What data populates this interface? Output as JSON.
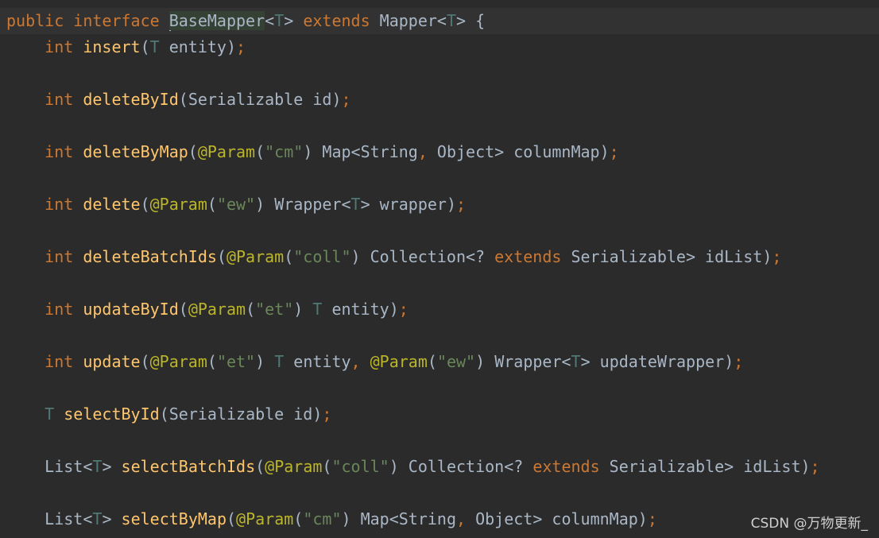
{
  "lines": [
    [
      {
        "t": "public",
        "k": "kw"
      },
      {
        "t": " "
      },
      {
        "t": "interface",
        "k": "kw"
      },
      {
        "t": " "
      },
      {
        "t": "CARET"
      },
      {
        "t": "BaseMapper",
        "k": "type",
        "h": true
      },
      {
        "t": "<",
        "k": "punc"
      },
      {
        "t": "T",
        "k": "gen"
      },
      {
        "t": ">",
        "k": "punc"
      },
      {
        "t": " "
      },
      {
        "t": "extends",
        "k": "kw"
      },
      {
        "t": " "
      },
      {
        "t": "Mapper",
        "k": "type"
      },
      {
        "t": "<",
        "k": "punc"
      },
      {
        "t": "T",
        "k": "gen"
      },
      {
        "t": ">",
        "k": "punc"
      },
      {
        "t": " "
      },
      {
        "t": "{",
        "k": "punc"
      }
    ],
    [
      {
        "t": "    "
      },
      {
        "t": "int",
        "k": "kw"
      },
      {
        "t": " "
      },
      {
        "t": "insert",
        "k": "fn"
      },
      {
        "t": "(",
        "k": "punc"
      },
      {
        "t": "T",
        "k": "gen"
      },
      {
        "t": " entity",
        "k": "type"
      },
      {
        "t": ")",
        "k": "punc"
      },
      {
        "t": ";",
        "k": "semi"
      }
    ],
    [
      {
        "t": "    "
      },
      {
        "t": "int",
        "k": "kw"
      },
      {
        "t": " "
      },
      {
        "t": "deleteById",
        "k": "fn"
      },
      {
        "t": "(",
        "k": "punc"
      },
      {
        "t": "Serializable id",
        "k": "type"
      },
      {
        "t": ")",
        "k": "punc"
      },
      {
        "t": ";",
        "k": "semi"
      }
    ],
    [
      {
        "t": "    "
      },
      {
        "t": "int",
        "k": "kw"
      },
      {
        "t": " "
      },
      {
        "t": "deleteByMap",
        "k": "fn"
      },
      {
        "t": "(",
        "k": "punc"
      },
      {
        "t": "@Param",
        "k": "ann"
      },
      {
        "t": "(",
        "k": "punc"
      },
      {
        "t": "\"cm\"",
        "k": "str"
      },
      {
        "t": ")",
        "k": "punc"
      },
      {
        "t": " Map<String",
        "k": "type"
      },
      {
        "t": ",",
        "k": "semi"
      },
      {
        "t": " Object> columnMap",
        "k": "type"
      },
      {
        "t": ")",
        "k": "punc"
      },
      {
        "t": ";",
        "k": "semi"
      }
    ],
    [
      {
        "t": "    "
      },
      {
        "t": "int",
        "k": "kw"
      },
      {
        "t": " "
      },
      {
        "t": "delete",
        "k": "fn"
      },
      {
        "t": "(",
        "k": "punc"
      },
      {
        "t": "@Param",
        "k": "ann"
      },
      {
        "t": "(",
        "k": "punc"
      },
      {
        "t": "\"ew\"",
        "k": "str"
      },
      {
        "t": ")",
        "k": "punc"
      },
      {
        "t": " Wrapper<",
        "k": "type"
      },
      {
        "t": "T",
        "k": "gen"
      },
      {
        "t": "> wrapper",
        "k": "type"
      },
      {
        "t": ")",
        "k": "punc"
      },
      {
        "t": ";",
        "k": "semi"
      }
    ],
    [
      {
        "t": "    "
      },
      {
        "t": "int",
        "k": "kw"
      },
      {
        "t": " "
      },
      {
        "t": "deleteBatchIds",
        "k": "fn"
      },
      {
        "t": "(",
        "k": "punc"
      },
      {
        "t": "@Param",
        "k": "ann"
      },
      {
        "t": "(",
        "k": "punc"
      },
      {
        "t": "\"coll\"",
        "k": "str"
      },
      {
        "t": ")",
        "k": "punc"
      },
      {
        "t": " Collection<? ",
        "k": "type"
      },
      {
        "t": "extends",
        "k": "kw"
      },
      {
        "t": " Serializable> idList",
        "k": "type"
      },
      {
        "t": ")",
        "k": "punc"
      },
      {
        "t": ";",
        "k": "semi"
      }
    ],
    [
      {
        "t": "    "
      },
      {
        "t": "int",
        "k": "kw"
      },
      {
        "t": " "
      },
      {
        "t": "updateById",
        "k": "fn"
      },
      {
        "t": "(",
        "k": "punc"
      },
      {
        "t": "@Param",
        "k": "ann"
      },
      {
        "t": "(",
        "k": "punc"
      },
      {
        "t": "\"et\"",
        "k": "str"
      },
      {
        "t": ")",
        "k": "punc"
      },
      {
        "t": " "
      },
      {
        "t": "T",
        "k": "gen"
      },
      {
        "t": " entity",
        "k": "type"
      },
      {
        "t": ")",
        "k": "punc"
      },
      {
        "t": ";",
        "k": "semi"
      }
    ],
    [
      {
        "t": "    "
      },
      {
        "t": "int",
        "k": "kw"
      },
      {
        "t": " "
      },
      {
        "t": "update",
        "k": "fn"
      },
      {
        "t": "(",
        "k": "punc"
      },
      {
        "t": "@Param",
        "k": "ann"
      },
      {
        "t": "(",
        "k": "punc"
      },
      {
        "t": "\"et\"",
        "k": "str"
      },
      {
        "t": ")",
        "k": "punc"
      },
      {
        "t": " "
      },
      {
        "t": "T",
        "k": "gen"
      },
      {
        "t": " entity",
        "k": "type"
      },
      {
        "t": ",",
        "k": "semi"
      },
      {
        "t": " "
      },
      {
        "t": "@Param",
        "k": "ann"
      },
      {
        "t": "(",
        "k": "punc"
      },
      {
        "t": "\"ew\"",
        "k": "str"
      },
      {
        "t": ")",
        "k": "punc"
      },
      {
        "t": " Wrapper<",
        "k": "type"
      },
      {
        "t": "T",
        "k": "gen"
      },
      {
        "t": "> updateWrapper",
        "k": "type"
      },
      {
        "t": ")",
        "k": "punc"
      },
      {
        "t": ";",
        "k": "semi"
      }
    ],
    [
      {
        "t": "    "
      },
      {
        "t": "T",
        "k": "gen"
      },
      {
        "t": " "
      },
      {
        "t": "selectById",
        "k": "fn"
      },
      {
        "t": "(",
        "k": "punc"
      },
      {
        "t": "Serializable id",
        "k": "type"
      },
      {
        "t": ")",
        "k": "punc"
      },
      {
        "t": ";",
        "k": "semi"
      }
    ],
    [
      {
        "t": "    "
      },
      {
        "t": "List<",
        "k": "type"
      },
      {
        "t": "T",
        "k": "gen"
      },
      {
        "t": "> ",
        "k": "type"
      },
      {
        "t": "selectBatchIds",
        "k": "fn"
      },
      {
        "t": "(",
        "k": "punc"
      },
      {
        "t": "@Param",
        "k": "ann"
      },
      {
        "t": "(",
        "k": "punc"
      },
      {
        "t": "\"coll\"",
        "k": "str"
      },
      {
        "t": ")",
        "k": "punc"
      },
      {
        "t": " Collection<? ",
        "k": "type"
      },
      {
        "t": "extends",
        "k": "kw"
      },
      {
        "t": " Serializable> idList",
        "k": "type"
      },
      {
        "t": ")",
        "k": "punc"
      },
      {
        "t": ";",
        "k": "semi"
      }
    ],
    [
      {
        "t": "    "
      },
      {
        "t": "List<",
        "k": "type"
      },
      {
        "t": "T",
        "k": "gen"
      },
      {
        "t": "> ",
        "k": "type"
      },
      {
        "t": "selectByMap",
        "k": "fn"
      },
      {
        "t": "(",
        "k": "punc"
      },
      {
        "t": "@Param",
        "k": "ann"
      },
      {
        "t": "(",
        "k": "punc"
      },
      {
        "t": "\"cm\"",
        "k": "str"
      },
      {
        "t": ")",
        "k": "punc"
      },
      {
        "t": " Map<String",
        "k": "type"
      },
      {
        "t": ",",
        "k": "semi"
      },
      {
        "t": " Object> columnMap",
        "k": "type"
      },
      {
        "t": ")",
        "k": "punc"
      },
      {
        "t": ";",
        "k": "semi"
      }
    ]
  ],
  "watermark": "CSDN @万物更新_",
  "colors": {
    "background": "#2b2b2b",
    "keyword": "#cc7832",
    "function": "#ffc66d",
    "annotation": "#bbb529",
    "string": "#6a8759",
    "generic": "#507874",
    "text": "#a9b7c6"
  }
}
